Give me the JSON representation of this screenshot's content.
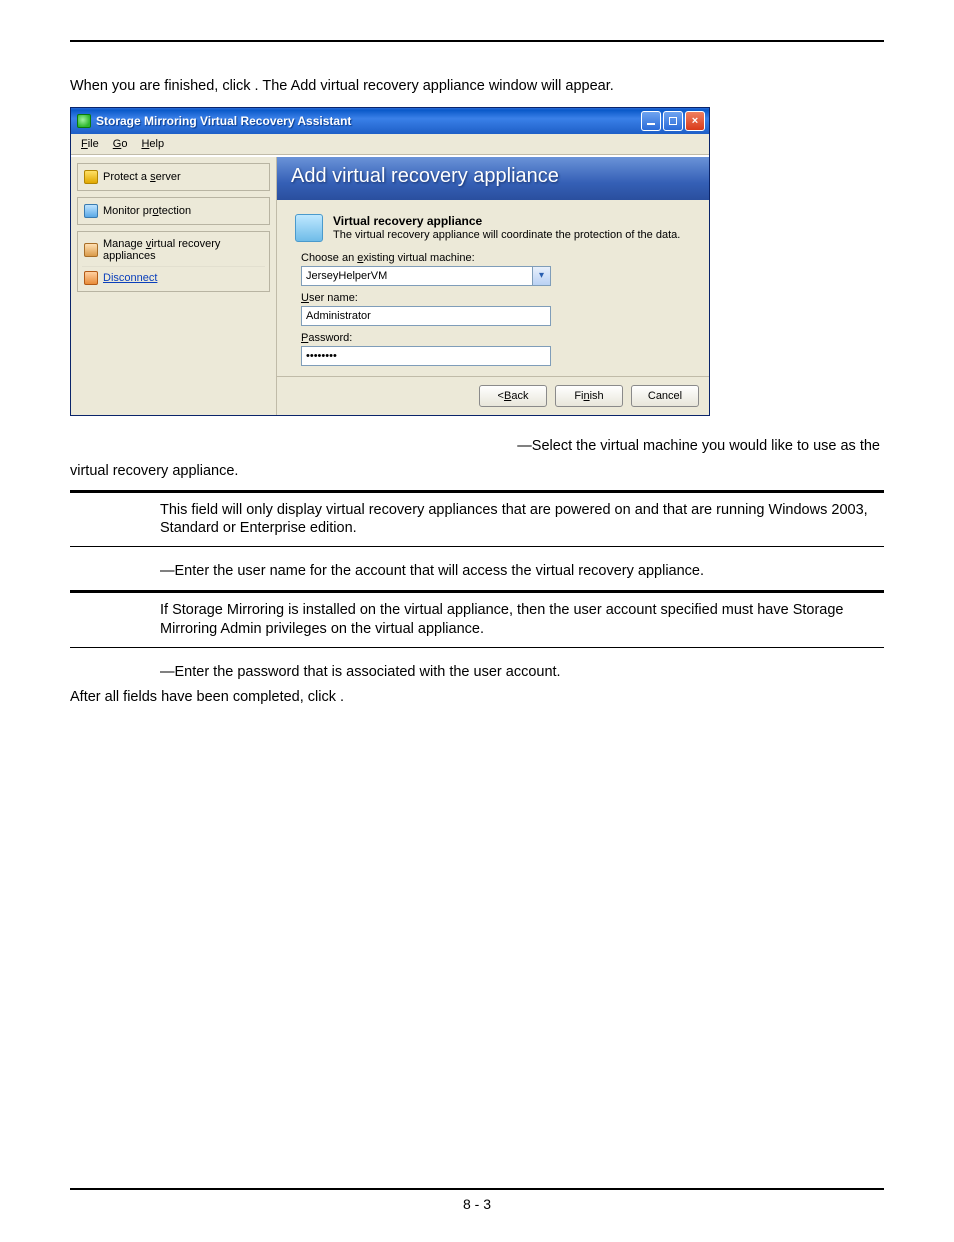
{
  "doc": {
    "intro": "When you are finished, click          . The Add virtual recovery appliance window will appear.",
    "bullet1_prefix": "—Select the virtual machine you would like to use as the ",
    "bullet1_suffix": "virtual recovery appliance.",
    "note1": "This field will only display virtual recovery appliances that are powered on and that are running Windows 2003, Standard or Enterprise edition.",
    "bullet2": "—Enter the user name for the account that will access the virtual recovery appliance.",
    "note2": "If Storage Mirroring is installed on the virtual appliance, then the user account specified must have Storage Mirroring Admin privileges on the virtual appliance.",
    "bullet3": "—Enter the password that is associated with the user account.",
    "closing": "After all fields have been completed, click            .",
    "page_number": "8 - 3"
  },
  "window": {
    "title": "Storage Mirroring Virtual Recovery Assistant",
    "menu": {
      "file": "File",
      "go": "Go",
      "help": "Help"
    },
    "controls": {
      "min": "_",
      "max": "▢",
      "close": "×"
    },
    "sidebar": {
      "protect": "Protect a server",
      "monitor": "Monitor protection",
      "manage": "Manage virtual recovery appliances",
      "disconnect": "Disconnect"
    },
    "content": {
      "header": "Add virtual recovery appliance",
      "section_head": "Virtual recovery appliance",
      "section_sub": "The virtual recovery appliance will coordinate the protection of the data.",
      "choose_label": "Choose an existing virtual machine:",
      "vm_value": "JerseyHelperVM",
      "user_label": "User name:",
      "user_value": "Administrator",
      "pass_label": "Password:",
      "pass_value": "••••••••"
    },
    "buttons": {
      "back": "< Back",
      "finish": "Finish",
      "cancel": "Cancel"
    }
  }
}
